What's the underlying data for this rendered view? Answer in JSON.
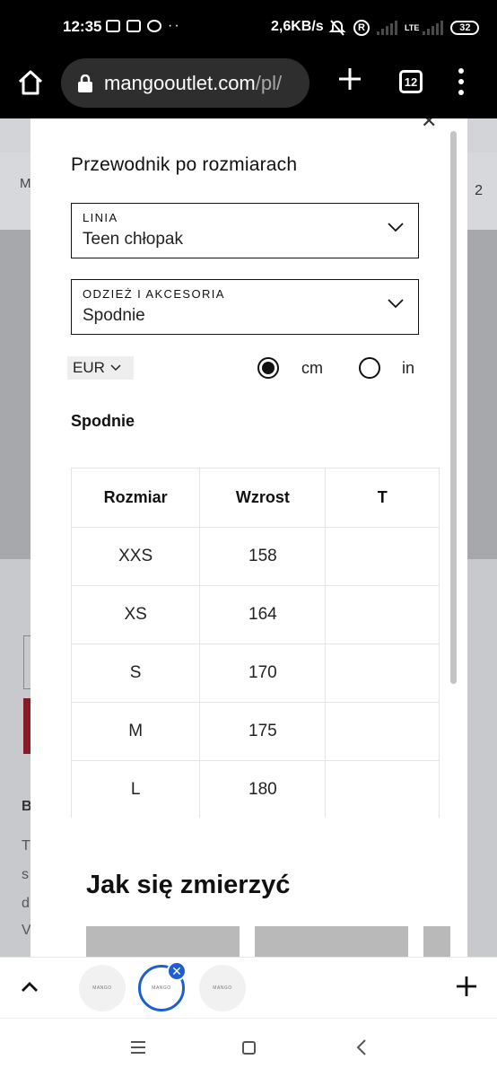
{
  "status_bar": {
    "time": "12:35",
    "speed": "2,6KB/s",
    "network": "LTE",
    "battery": "32",
    "roaming": "R"
  },
  "browser": {
    "url_host": "mangooutlet.com",
    "url_path": "/pl/",
    "tab_count": "12"
  },
  "background_page": {
    "menu_label": "M",
    "cart_count": "2",
    "text_fragments": [
      "B",
      "T",
      "s",
      "d",
      "V"
    ]
  },
  "modal": {
    "title": "Przewodnik po rozmiarach",
    "line_dropdown": {
      "label": "LINIA",
      "value": "Teen chłopak"
    },
    "category_dropdown": {
      "label": "ODZIEŻ I AKCESORIA",
      "value": "Spodnie"
    },
    "currency": "EUR",
    "units": [
      {
        "label": "cm",
        "selected": true
      },
      {
        "label": "in",
        "selected": false
      }
    ],
    "section_title": "Spodnie",
    "table": {
      "headers": [
        "Rozmiar",
        "Wzrost",
        "T"
      ],
      "rows": [
        [
          "XXS",
          "158",
          ""
        ],
        [
          "XS",
          "164",
          ""
        ],
        [
          "S",
          "170",
          ""
        ],
        [
          "M",
          "175",
          ""
        ],
        [
          "L",
          "180",
          ""
        ]
      ]
    },
    "measure_title": "Jak się zmierzyć"
  },
  "tab_strip": {
    "tabs": [
      {
        "label": "MANGO",
        "active": false
      },
      {
        "label": "MANGO",
        "active": true
      },
      {
        "label": "MANGO",
        "active": false
      }
    ]
  },
  "colors": {
    "accent_blue": "#1e5fcf",
    "toolbar_bg": "#000000",
    "overlay_bg": "#c9ccd0"
  }
}
